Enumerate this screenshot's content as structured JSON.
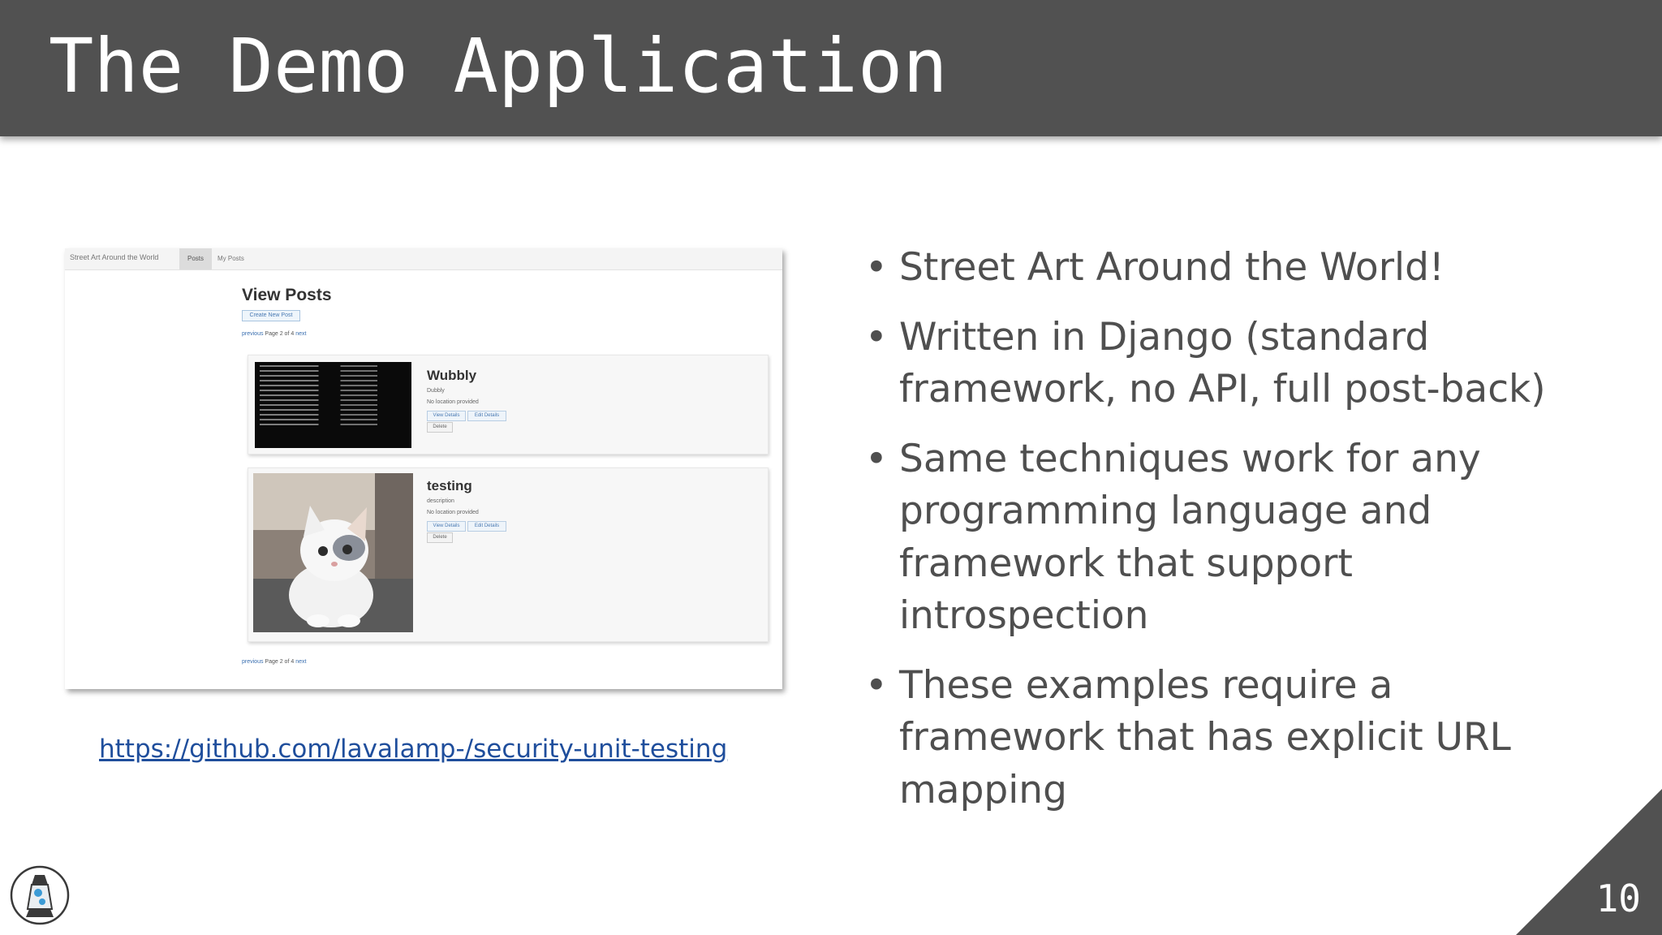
{
  "slide": {
    "title": "The Demo Application",
    "page_number": "10"
  },
  "screenshot": {
    "nav_brand": "Street Art Around the World",
    "nav_tab_posts": "Posts",
    "nav_tab_my_posts": "My Posts",
    "heading": "View Posts",
    "create_button": "Create New Post",
    "pager_prev": "previous",
    "pager_text": "Page 2 of 4",
    "pager_next": "next",
    "posts": [
      {
        "title": "Wubbly",
        "description": "Dubbly",
        "location": "No location provided",
        "view_button": "View Details",
        "edit_button": "Edit Details",
        "delete_button": "Delete"
      },
      {
        "title": "testing",
        "description": "description",
        "location": "No location provided",
        "view_button": "View Details",
        "edit_button": "Edit Details",
        "delete_button": "Delete"
      }
    ]
  },
  "link": {
    "text": "https://github.com/lavalamp-/security-unit-testing"
  },
  "bullets": [
    "Street Art Around the World!",
    "Written in Django (standard framework, no API, full post-back)",
    "Same techniques work for any programming language and framework that support introspection",
    "These examples require a framework that has explicit URL mapping"
  ],
  "colors": {
    "title_bar": "#515151",
    "link": "#1f4e9c",
    "body_text": "#4f4f4f"
  }
}
